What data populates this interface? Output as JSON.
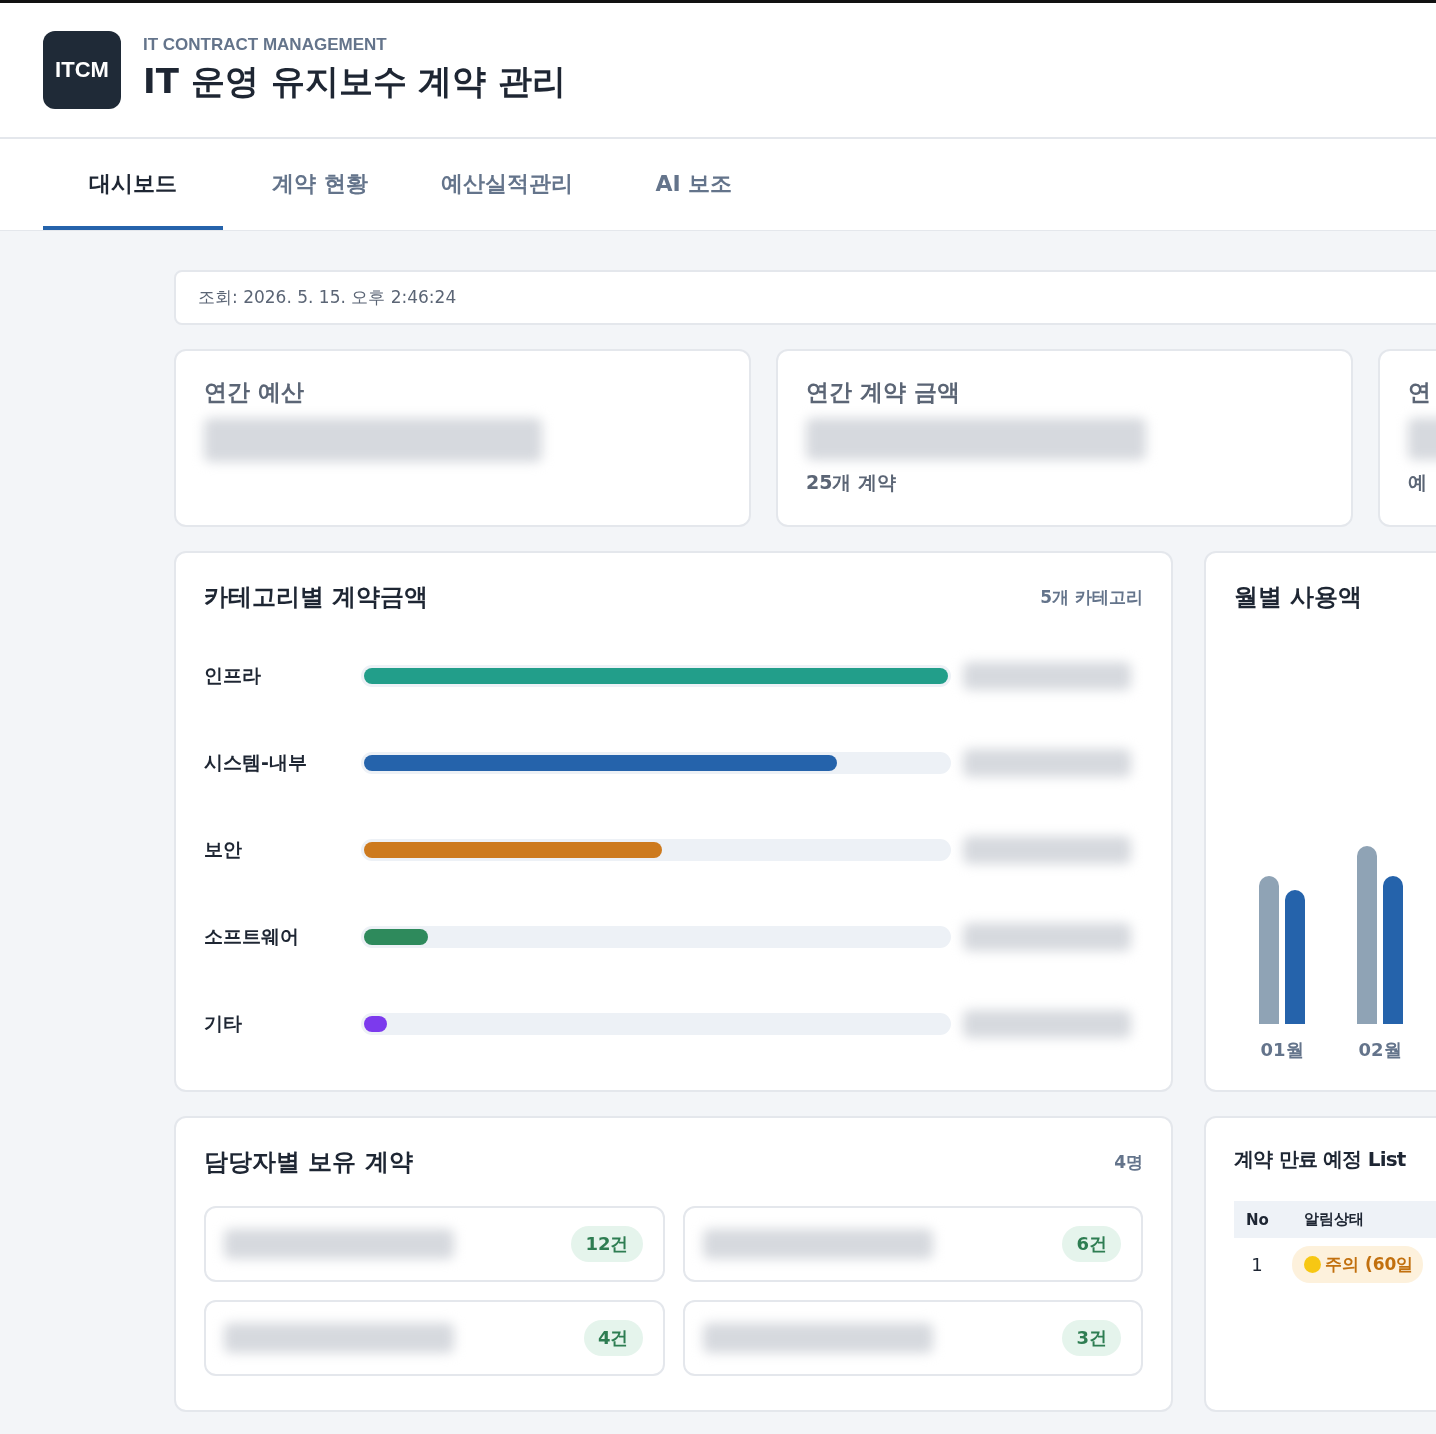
{
  "header": {
    "logo": "ITCM",
    "subtitle": "IT CONTRACT MANAGEMENT",
    "title": "IT 운영 유지보수 계약 관리"
  },
  "tabs": [
    {
      "label": "대시보드",
      "selected": true
    },
    {
      "label": "계약 현황",
      "selected": false
    },
    {
      "label": "예산실적관리",
      "selected": false
    },
    {
      "label": "AI 보조",
      "selected": false
    }
  ],
  "query_time": "조회: 2026. 5. 15. 오후 2:46:24",
  "summary_cards": [
    {
      "title": "연간 예산"
    },
    {
      "title": "연간 계약 금액",
      "note": "25개 계약"
    },
    {
      "title": "연",
      "note": "예"
    }
  ],
  "category_panel": {
    "title": "카테고리별 계약금액",
    "count": "5개 카테고리",
    "items": [
      {
        "name": "인프라",
        "level": 1.0,
        "color": "#229e8a"
      },
      {
        "name": "시스템-내부",
        "level": 0.81,
        "color": "#2563ab"
      },
      {
        "name": "보안",
        "level": 0.51,
        "color": "#cd7a1e"
      },
      {
        "name": "소프트웨어",
        "level": 0.11,
        "color": "#2e8a5c"
      },
      {
        "name": "기타",
        "level": 0.04,
        "color": "#7c3aed"
      }
    ]
  },
  "monthly_panel": {
    "title": "월별 사용액",
    "months": [
      "01월",
      "02월"
    ]
  },
  "manager_panel": {
    "title": "담당자별 보유 계약",
    "count": "4명",
    "managers": [
      {
        "count": "12건"
      },
      {
        "count": "6건"
      },
      {
        "count": "4건"
      },
      {
        "count": "3건"
      }
    ]
  },
  "expiry_panel": {
    "title": "계약 만료 예정 List",
    "columns": [
      "No",
      "알림상태"
    ],
    "rows": [
      {
        "no": "1",
        "status": "주의 (60일"
      }
    ]
  }
}
